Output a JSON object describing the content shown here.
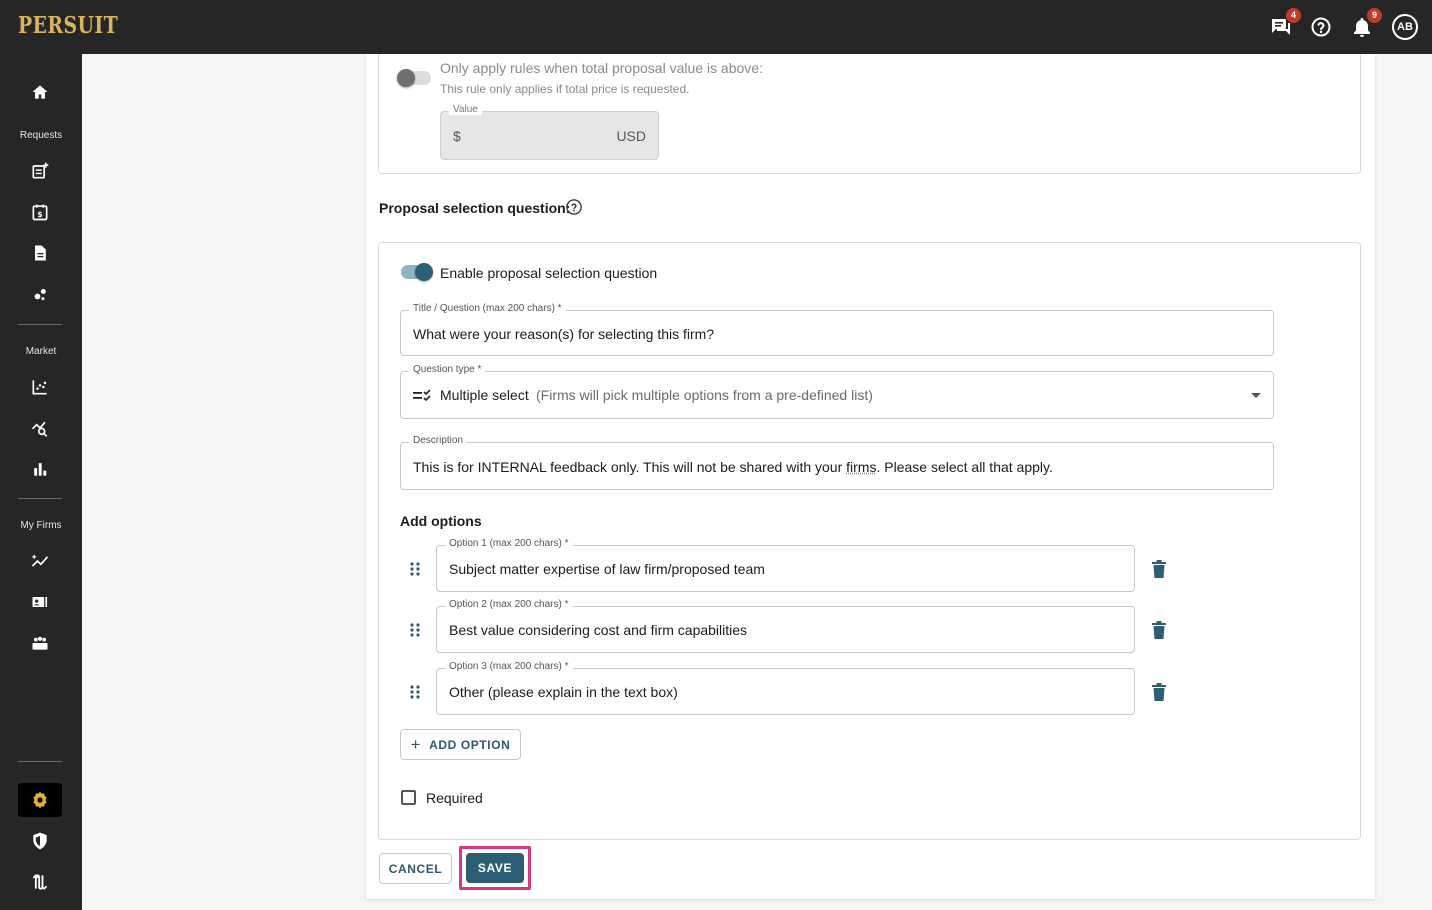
{
  "header": {
    "logo": "PERSUIT",
    "messages_badge": "4",
    "notifications_badge": "9",
    "avatar_initials": "AB"
  },
  "sidebar": {
    "section_requests": "Requests",
    "section_market": "Market",
    "section_my_firms": "My Firms"
  },
  "threshold": {
    "label": "Only apply rules when total proposal value is above:",
    "hint": "This rule only applies if total price is requested.",
    "value_label": "Value",
    "currency_symbol": "$",
    "currency_code": "USD",
    "enabled": false
  },
  "selection_question": {
    "heading": "Proposal selection question:",
    "enable_label": "Enable proposal selection question",
    "enabled": true,
    "title_label": "Title / Question (max 200 chars) *",
    "title_value": "What were your reason(s) for selecting this firm?",
    "type_label": "Question type *",
    "type_value": "Multiple select",
    "type_hint": "(Firms will pick multiple options from a pre-defined list)",
    "description_label": "Description",
    "description_value_before": "This is for INTERNAL feedback only. This will not be shared with your ",
    "description_value_firms": "firms",
    "description_value_after": ". Please select all that apply.",
    "add_options_heading": "Add options",
    "options": [
      {
        "label": "Option 1 (max 200 chars) *",
        "value": "Subject matter expertise of law firm/proposed team"
      },
      {
        "label": "Option 2 (max 200 chars) *",
        "value": "Best value considering cost and firm capabilities"
      },
      {
        "label": "Option 3 (max 200 chars) *",
        "value": "Other (please explain in the text box)"
      }
    ],
    "add_option_button": "ADD OPTION",
    "required_label": "Required",
    "required_checked": false
  },
  "actions": {
    "cancel": "CANCEL",
    "save": "SAVE"
  },
  "colors": {
    "topbar": "#262626",
    "logo": "#d9b45b",
    "accent": "#2d5f74",
    "highlight": "#d6377f",
    "badge": "#c0392b"
  }
}
